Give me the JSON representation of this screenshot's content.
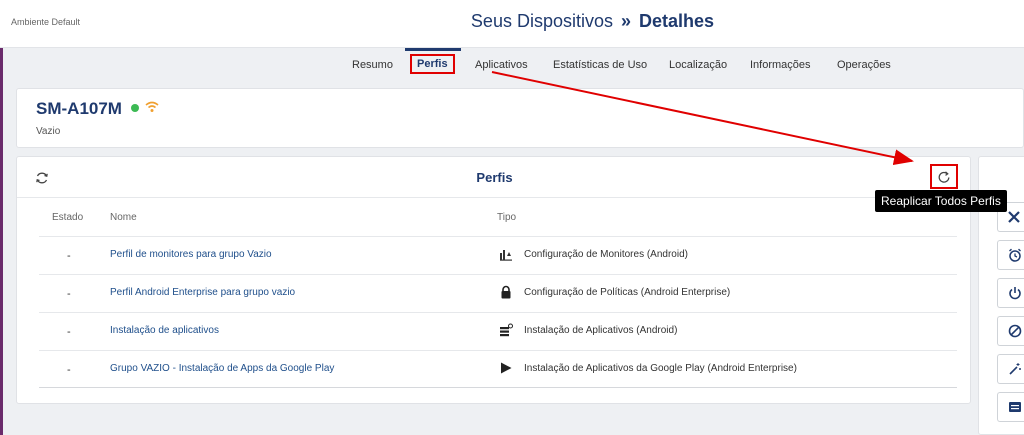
{
  "header": {
    "environment": "Ambiente Default",
    "title_part1": "Seus Dispositivos",
    "title_sep": "»",
    "title_part2": "Detalhes"
  },
  "tabs": [
    {
      "label": "Resumo",
      "active": false
    },
    {
      "label": "Perfis",
      "active": true
    },
    {
      "label": "Aplicativos",
      "active": false
    },
    {
      "label": "Estatísticas de Uso",
      "active": false
    },
    {
      "label": "Localização",
      "active": false
    },
    {
      "label": "Informações",
      "active": false
    },
    {
      "label": "Operações",
      "active": false
    }
  ],
  "device": {
    "name": "SM-A107M",
    "group": "Vazio",
    "status_color": "#3cba54",
    "wifi_color": "#f0a030"
  },
  "profiles": {
    "title": "Perfis",
    "tooltip": "Reaplicar Todos Perfis",
    "columns": {
      "estado": "Estado",
      "nome": "Nome",
      "tipo": "Tipo"
    },
    "rows": [
      {
        "estado": "-",
        "nome": "Perfil de monitores para grupo Vazio",
        "tipo": "Configuração de Monitores (Android)",
        "icon": "monitor-chart-icon"
      },
      {
        "estado": "-",
        "nome": "Perfil Android Enterprise para grupo vazio",
        "tipo": "Configuração de Políticas (Android Enterprise)",
        "icon": "lock-icon"
      },
      {
        "estado": "-",
        "nome": "Instalação de aplicativos",
        "tipo": "Instalação de Aplicativos (Android)",
        "icon": "app-stack-icon"
      },
      {
        "estado": "-",
        "nome": "Grupo VAZIO - Instalação de Apps da Google Play",
        "tipo": "Instalação de Aplicativos da Google Play (Android Enterprise)",
        "icon": "google-play-icon"
      }
    ]
  },
  "side_actions": [
    {
      "icon": "close-icon"
    },
    {
      "icon": "alarm-icon"
    },
    {
      "icon": "power-icon"
    },
    {
      "icon": "block-icon"
    },
    {
      "icon": "magic-wand-icon"
    },
    {
      "icon": "message-icon"
    }
  ],
  "colors": {
    "brand": "#1f3a6e",
    "highlight": "#e00000",
    "link": "#1f4f8b",
    "sidebar_accent": "#6a2b6b"
  }
}
